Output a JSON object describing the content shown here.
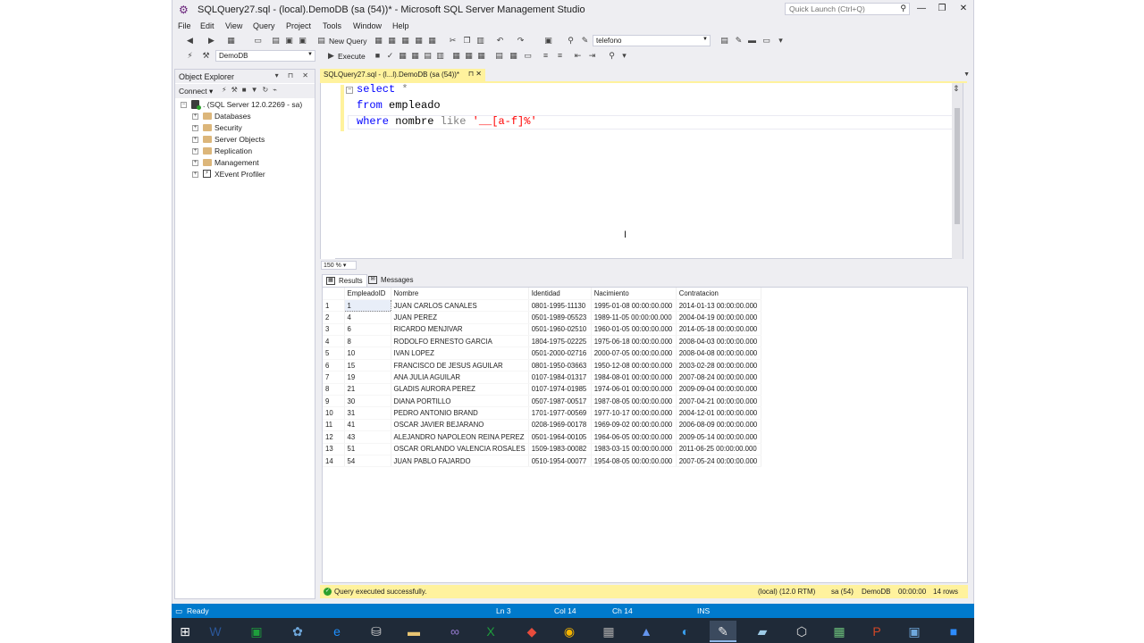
{
  "window": {
    "title": "SQLQuery27.sql - (local).DemoDB (sa (54))* - Microsoft SQL Server Management Studio",
    "quick_launch_placeholder": "Quick Launch (Ctrl+Q)",
    "minimize": "—",
    "maximize": "❐",
    "close": "✕"
  },
  "menu": [
    "File",
    "Edit",
    "View",
    "Query",
    "Project",
    "Tools",
    "Window",
    "Help"
  ],
  "toolbar": {
    "new_query": "New Query",
    "database_combo": "telefono",
    "db_selector": "DemoDB",
    "execute": "Execute"
  },
  "object_explorer": {
    "title": "Object Explorer",
    "connect": "Connect",
    "server": ". (SQL Server 12.0.2269 - sa)",
    "nodes": [
      "Databases",
      "Security",
      "Server Objects",
      "Replication",
      "Management",
      "XEvent Profiler"
    ]
  },
  "document_tab": {
    "label": "SQLQuery27.sql - (l...l).DemoDB (sa (54))*",
    "pin": "⊓",
    "close": "✕"
  },
  "editor": {
    "line1_kw": "select",
    "line1_rest": " *",
    "line2_kw": "from",
    "line2_rest": " empleado",
    "line3_kw": "where",
    "line3_col": " nombre ",
    "line3_op": "like",
    "line3_str": " '__[a-f]%'",
    "zoom": "150 %"
  },
  "results": {
    "tab_results": "Results",
    "tab_messages": "Messages",
    "columns": [
      "EmpleadoID",
      "Nombre",
      "Identidad",
      "Nacimiento",
      "Contratacion"
    ],
    "rows": [
      [
        "1",
        "1",
        "JUAN CARLOS CANALES",
        "0801-1995-11130",
        "1995-01-08 00:00:00.000",
        "2014-01-13 00:00:00.000"
      ],
      [
        "2",
        "4",
        "JUAN PEREZ",
        "0501-1989-05523",
        "1989-11-05 00:00:00.000",
        "2004-04-19 00:00:00.000"
      ],
      [
        "3",
        "6",
        "RICARDO MENJIVAR",
        "0501-1960-02510",
        "1960-01-05 00:00:00.000",
        "2014-05-18 00:00:00.000"
      ],
      [
        "4",
        "8",
        "RODOLFO ERNESTO GARCIA",
        "1804-1975-02225",
        "1975-06-18 00:00:00.000",
        "2008-04-03 00:00:00.000"
      ],
      [
        "5",
        "10",
        "IVAN LOPEZ",
        "0501-2000-02716",
        "2000-07-05 00:00:00.000",
        "2008-04-08 00:00:00.000"
      ],
      [
        "6",
        "15",
        "FRANCISCO DE JESUS AGUILAR",
        "0801-1950-03663",
        "1950-12-08 00:00:00.000",
        "2003-02-28 00:00:00.000"
      ],
      [
        "7",
        "19",
        "ANA JULIA AGUILAR",
        "0107-1984-01317",
        "1984-08-01 00:00:00.000",
        "2007-08-24 00:00:00.000"
      ],
      [
        "8",
        "21",
        "GLADIS AURORA PEREZ",
        "0107-1974-01985",
        "1974-06-01 00:00:00.000",
        "2009-09-04 00:00:00.000"
      ],
      [
        "9",
        "30",
        "DIANA PORTILLO",
        "0507-1987-00517",
        "1987-08-05 00:00:00.000",
        "2007-04-21 00:00:00.000"
      ],
      [
        "10",
        "31",
        "PEDRO ANTONIO BRAND",
        "1701-1977-00569",
        "1977-10-17 00:00:00.000",
        "2004-12-01 00:00:00.000"
      ],
      [
        "11",
        "41",
        "OSCAR JAVIER BEJARANO",
        "0208-1969-00178",
        "1969-09-02 00:00:00.000",
        "2006-08-09 00:00:00.000"
      ],
      [
        "12",
        "43",
        "ALEJANDRO NAPOLEON REINA PEREZ",
        "0501-1964-00105",
        "1964-06-05 00:00:00.000",
        "2009-05-14 00:00:00.000"
      ],
      [
        "13",
        "51",
        "OSCAR ORLANDO VALENCIA ROSALES",
        "1509-1983-00082",
        "1983-03-15 00:00:00.000",
        "2011-06-25 00:00:00.000"
      ],
      [
        "14",
        "54",
        "JUAN PABLO FAJARDO",
        "0510-1954-00077",
        "1954-08-05 00:00:00.000",
        "2007-05-24 00:00:00.000"
      ]
    ]
  },
  "query_status": {
    "message": "Query executed successfully.",
    "server": "(local) (12.0 RTM)",
    "user": "sa (54)",
    "database": "DemoDB",
    "elapsed": "00:00:00",
    "rows": "14 rows"
  },
  "statusbar": {
    "ready": "Ready",
    "ln": "Ln 3",
    "col": "Col 14",
    "ch": "Ch 14",
    "ins": "INS"
  },
  "colors": {
    "accent": "#007acc",
    "tab_yellow": "#fff29d",
    "keyword": "#0000ff",
    "string": "#ff0000"
  }
}
